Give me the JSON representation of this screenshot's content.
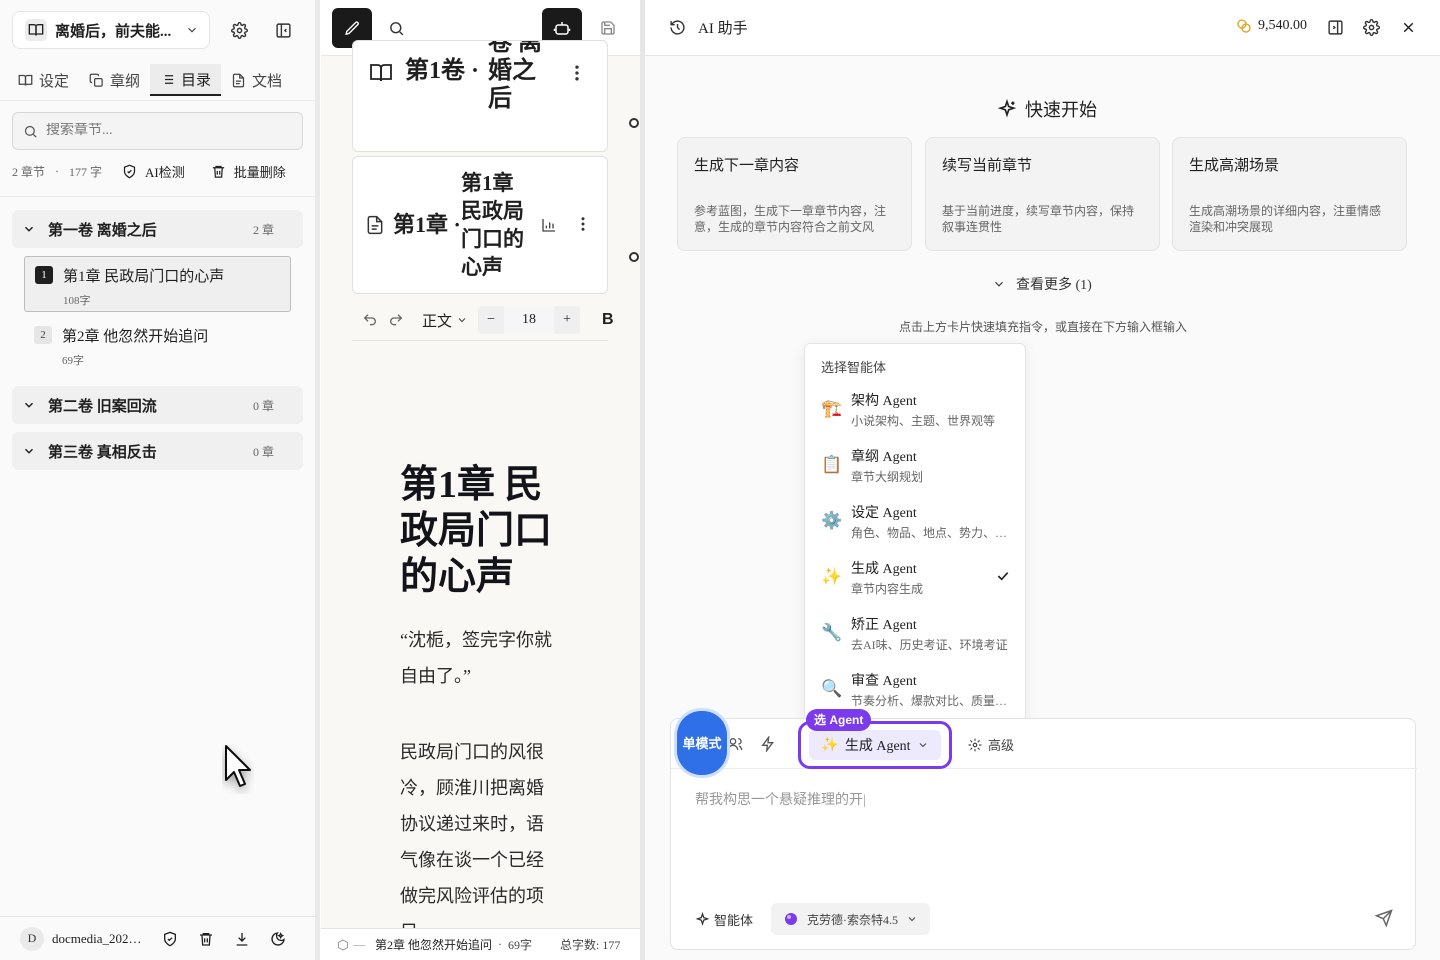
{
  "left": {
    "book_title": "离婚后，前夫能...",
    "tabs": [
      {
        "label": "设定"
      },
      {
        "label": "章纲"
      },
      {
        "label": "目录"
      },
      {
        "label": "文档"
      }
    ],
    "search_placeholder": "搜索章节...",
    "stats": {
      "chapters": "2 章节",
      "sep": "·",
      "words": "177 字",
      "ai_check": "AI检测",
      "batch_delete": "批量删除"
    },
    "volumes": [
      {
        "name": "第一卷 离婚之后",
        "count": "2 章"
      },
      {
        "name": "第二卷 旧案回流",
        "count": "0 章"
      },
      {
        "name": "第三卷 真相反击",
        "count": "0 章"
      }
    ],
    "chapters": [
      {
        "num": "1",
        "title": "第1章 民政局门口的心声",
        "words": "108字"
      },
      {
        "num": "2",
        "title": "第2章 他忽然开始追问",
        "words": "69字"
      }
    ],
    "user": {
      "initial": "D",
      "name": "docmedia_2026..."
    }
  },
  "mid": {
    "vol_card_prefix": "第1卷 ·",
    "vol_card_title": "卷 离婚之后",
    "ch_card_prefix": "第1章 ·",
    "ch_card_title": "第1章 民政局门口的心声",
    "style_label": "正文",
    "font_size": "18",
    "bold_label": "B",
    "doc_title": "第1章 民政局门口的心声",
    "para1": "“沈栀，签完字你就自由了。”",
    "para2": "民政局门口的风很冷，顾淮川把离婚协议递过来时，语气像在谈一个已经做完风险评估的项目",
    "status": {
      "prefix": "—",
      "chapter": "第2章 他忽然开始追问",
      "sep": "·",
      "words": "69字",
      "total": "总字数: 177"
    }
  },
  "right": {
    "title": "AI 助手",
    "credits": "9,540.00",
    "quick_start": "快速开始",
    "cards": [
      {
        "title": "生成下一章内容",
        "desc": "参考蓝图，生成下一章章节内容，注意，生成的章节内容符合之前文风"
      },
      {
        "title": "续写当前章节",
        "desc": "基于当前进度，续写章节内容，保持叙事连贯性"
      },
      {
        "title": "生成高潮场景",
        "desc": "生成高潮场景的详细内容，注重情感渲染和冲突展现"
      }
    ],
    "see_more": "查看更多 (1)",
    "hint": "点击上方卡片快速填充指令，或直接在下方输入框输入",
    "menu": {
      "header": "选择智能体",
      "items": [
        {
          "emoji": "🏗️",
          "name": "架构 Agent",
          "desc": "小说架构、主题、世界观等"
        },
        {
          "emoji": "📋",
          "name": "章纲 Agent",
          "desc": "章节大纲规划"
        },
        {
          "emoji": "⚙️",
          "name": "设定 Agent",
          "desc": "角色、物品、地点、势力、事件等"
        },
        {
          "emoji": "✨",
          "name": "生成 Agent",
          "desc": "章节内容生成"
        },
        {
          "emoji": "🔧",
          "name": "矫正 Agent",
          "desc": "去AI味、历史考证、环境考证"
        },
        {
          "emoji": "🔍",
          "name": "审查 Agent",
          "desc": "节奏分析、爆款对比、质量检测"
        }
      ],
      "selected": "生成 Agent"
    },
    "input": {
      "mode_badge": "单模式",
      "agent_tag": "选 Agent",
      "agent_emoji": "✨",
      "agent_label": "生成 Agent",
      "advanced": "高级",
      "prompt": "帮我构思一个悬疑推理的开|",
      "agents_btn": "智能体",
      "model": "克劳德·索奈特4.5"
    }
  }
}
